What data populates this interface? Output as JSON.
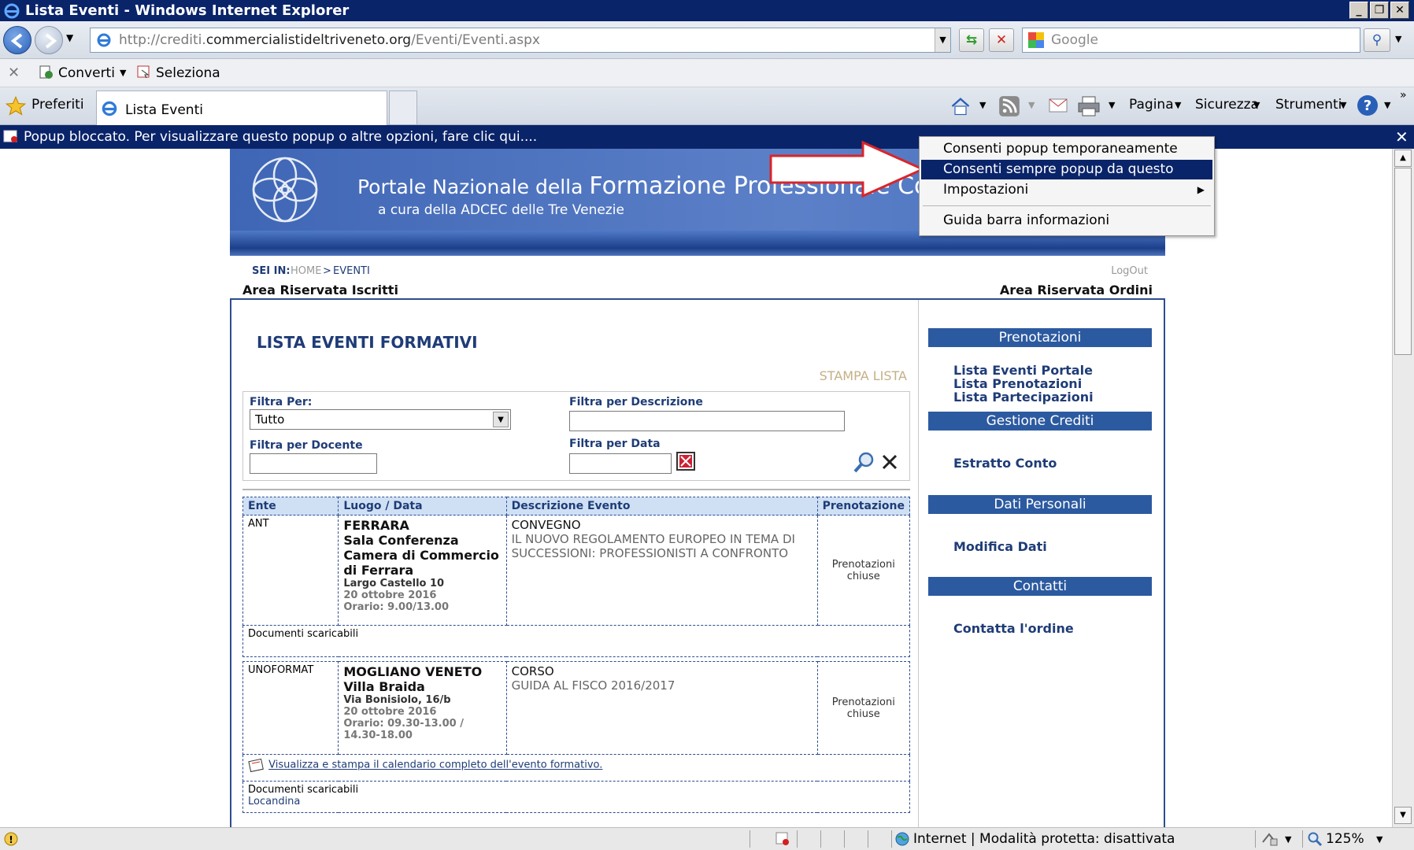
{
  "window": {
    "title": "Lista Eventi - Windows Internet Explorer"
  },
  "address_bar": {
    "url_prefix": "http://crediti.",
    "url_domain": "commercialistideltriveneto.org",
    "url_path": "/Eventi/Eventi.aspx",
    "search_placeholder": "Google"
  },
  "command_bar": {
    "convert_label": "Converti",
    "select_label": "Seleziona"
  },
  "tab_bar": {
    "favorites_label": "Preferiti",
    "tab_title": "Lista Eventi",
    "page_menu": "Pagina",
    "security_menu": "Sicurezza",
    "tools_menu": "Strumenti"
  },
  "info_bar": {
    "message": "Popup bloccato. Per visualizzare questo popup o altre opzioni, fare clic qui...."
  },
  "context_menu": {
    "items": [
      "Consenti popup temporaneamente",
      "Consenti sempre popup da questo sito...",
      "Impostazioni",
      "Guida barra informazioni"
    ]
  },
  "site": {
    "banner_title_small": "Portale Nazionale della ",
    "banner_title_big": "Formazione Professionale Continua",
    "banner_subtitle": "a cura della ADCEC delle Tre Venezie",
    "breadcrumb_label": "SEI IN:",
    "breadcrumb_home": "HOME",
    "breadcrumb_sep": ">",
    "breadcrumb_current": "EVENTI",
    "logout": "LogOut",
    "area_left": "Area Riservata Iscritti",
    "area_right": "Area Riservata Ordini"
  },
  "main": {
    "heading": "LISTA EVENTI FORMATIVI",
    "print_list": "STAMPA LISTA",
    "filters": {
      "filter_by_label": "Filtra Per:",
      "filter_by_value": "Tutto",
      "desc_label": "Filtra per Descrizione",
      "teacher_label": "Filtra per Docente",
      "date_label": "Filtra per Data"
    },
    "table_headers": [
      "Ente",
      "Luogo / Data",
      "Descrizione Evento",
      "Prenotazione"
    ],
    "events": [
      {
        "ente": "ANT",
        "place": "FERRARA",
        "venue": "Sala Conferenza Camera di Commercio di Ferrara",
        "address": "Largo Castello 10",
        "date": "20 ottobre 2016",
        "time": "Orario: 9.00/13.00",
        "type": "CONVEGNO",
        "description": "IL NUOVO REGOLAMENTO EUROPEO IN TEMA DI SUCCESSIONI: PROFESSIONISTI A CONFRONTO",
        "booking": "Prenotazioni chiuse",
        "docs": "Documenti scaricabili"
      },
      {
        "ente": "UNOFORMAT",
        "place": "MOGLIANO VENETO",
        "venue": "Villa Braida",
        "address": "Via Bonisiolo, 16/b",
        "date": "20 ottobre 2016",
        "time": "Orario: 09.30-13.00 / 14.30-18.00",
        "type": "CORSO",
        "description": "GUIDA AL FISCO 2016/2017",
        "booking": "Prenotazioni chiuse",
        "calendar_link": "Visualizza e stampa il calendario completo dell'evento formativo.",
        "docs": "Documenti scaricabili",
        "doc_link": "Locandina"
      }
    ]
  },
  "sidebar": {
    "sections": [
      {
        "title": "Prenotazioni",
        "links": [
          "Lista Eventi Portale",
          "Lista Prenotazioni",
          "Lista Partecipazioni"
        ]
      },
      {
        "title": "Gestione Crediti",
        "links": [
          "Estratto Conto"
        ]
      },
      {
        "title": "Dati Personali",
        "links": [
          "Modifica Dati"
        ]
      },
      {
        "title": "Contatti",
        "links": [
          "Contatta l'ordine"
        ]
      }
    ]
  },
  "status_bar": {
    "zone": "Internet | Modalità protetta: disattivata",
    "zoom": "125%"
  },
  "colors": {
    "titlebar": "#0a246a",
    "site_blue": "#2c5aa0",
    "link_navy": "#1f3c77",
    "arrow_red": "#d9252a"
  }
}
